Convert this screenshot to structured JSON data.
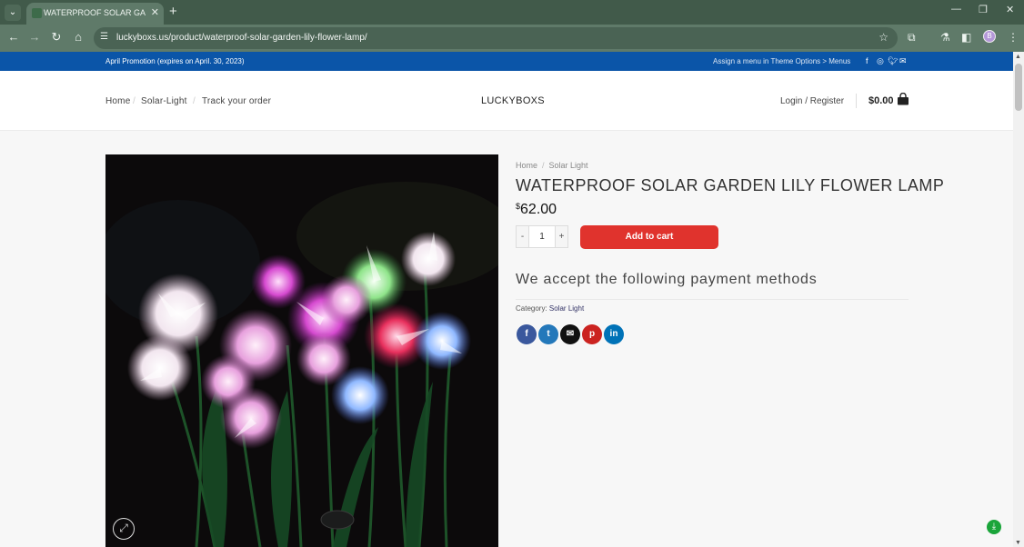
{
  "browser": {
    "tab_title": "WATERPROOF SOLAR GARDEN",
    "url": "luckyboxs.us/product/waterproof-solar-garden-lily-flower-lamp/",
    "profile_initial": "B"
  },
  "topbar": {
    "promo": "April Promotion (expires on April. 30, 2023)",
    "assign_menu": "Assign a menu in Theme Options > Menus"
  },
  "header": {
    "nav": [
      "Home",
      "Solar-Light",
      "Track your order"
    ],
    "logo": "LUCKYBOXS",
    "login": "Login / Register",
    "cart_total": "$0.00"
  },
  "product": {
    "breadcrumb": [
      "Home",
      "Solar Light"
    ],
    "title": "WATERPROOF SOLAR GARDEN LILY FLOWER LAMP",
    "currency": "$",
    "price": "62.00",
    "quantity": "1",
    "qty_minus": "-",
    "qty_plus": "+",
    "add_to_cart": "Add to cart",
    "payment_heading": "We accept the following payment methods",
    "category_label": "Category:",
    "category_value": "Solar Light"
  },
  "share": [
    {
      "icon": "facebook-icon",
      "glyph": "f",
      "color": "#3a589d"
    },
    {
      "icon": "twitter-icon",
      "glyph": "t",
      "color": "#2478ba"
    },
    {
      "icon": "email-icon",
      "glyph": "✉",
      "color": "#111111"
    },
    {
      "icon": "pinterest-icon",
      "glyph": "p",
      "color": "#cb2320"
    },
    {
      "icon": "linkedin-icon",
      "glyph": "in",
      "color": "#0072b7"
    }
  ],
  "colors": {
    "topbar": "#0b55a8",
    "add_to_cart": "#e0332d",
    "browser_chrome": "#5f7a69"
  }
}
